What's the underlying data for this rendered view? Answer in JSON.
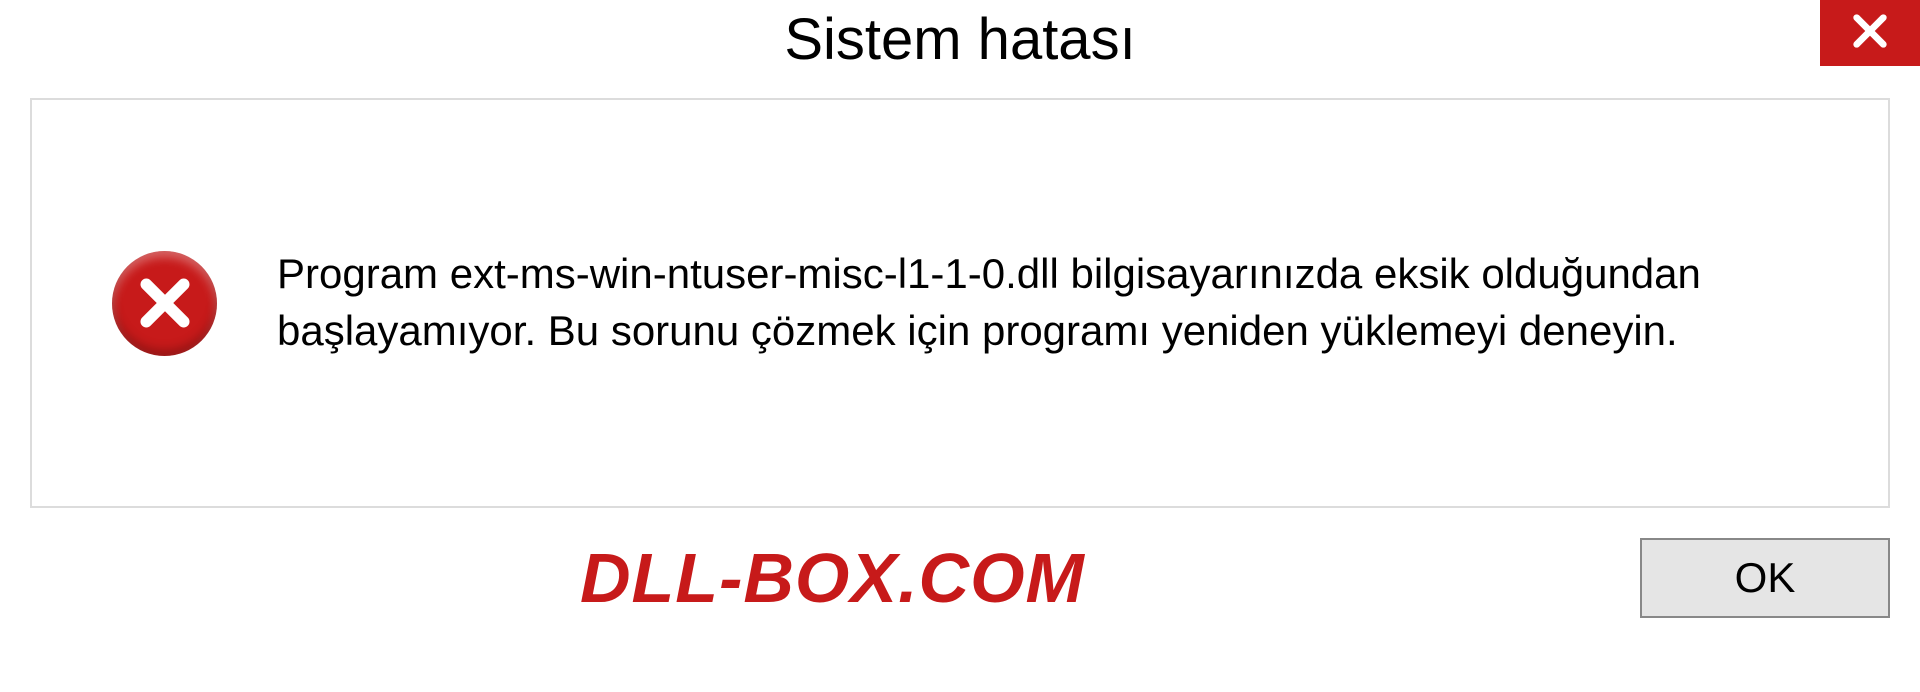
{
  "titlebar": {
    "title": "Sistem hatası"
  },
  "dialog": {
    "message": "Program ext-ms-win-ntuser-misc-l1-1-0.dll bilgisayarınızda eksik olduğundan başlayamıyor. Bu sorunu çözmek için programı yeniden yüklemeyi deneyin."
  },
  "footer": {
    "watermark": "DLL-BOX.COM",
    "ok_label": "OK"
  }
}
